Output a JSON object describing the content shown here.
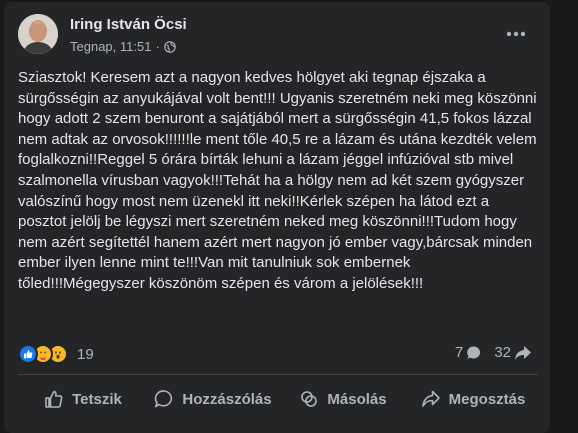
{
  "post": {
    "author": "Iring István Öcsi",
    "timestamp": "Tegnap, 11:51",
    "separator": "·",
    "privacy_icon": "globe-icon",
    "more_icon": "more-options-icon",
    "text": "Sziasztok! Keresem azt a nagyon kedves hölgyet aki tegnap éjszaka a sürgősségin az anyukájával volt bent!!! Ugyanis szeretném neki meg köszönni hogy adott 2 szem benuront a sajátjából mert a sürgősségin 41,5 fokos lázzal nem adtak az orvosok!!!!!!le ment tőle 40,5 re a lázam és utána kezdték velem foglalkozni!!Reggel 5 órára bírták lehuni a lázam jéggel infúzióval stb mivel szalmonella vírusban vagyok!!!Tehát ha a hölgy nem ad két szem gyógyszer valószínű hogy most nem üzenekl itt neki!!Kérlek szépen ha látod ezt a posztot jelölj be légyszi mert szeretném neked meg köszönni!!!Tudom hogy nem azért segítettél hanem azért mert nagyon jó ember vagy,bárcsak minden ember ilyen lenne mint te!!!Van mit tanulniuk sok embernek tőled!!!Mégegyszer köszönöm szépen és várom a jelölések!!!"
  },
  "stats": {
    "reactions": [
      "like",
      "care",
      "wow"
    ],
    "reaction_count": "19",
    "comment_count": "7",
    "share_count": "32"
  },
  "actions": {
    "like_label": "Tetszik",
    "comment_label": "Hozzászólás",
    "copy_label": "Másolás",
    "share_label": "Megosztás"
  },
  "colors": {
    "background": "#18191a",
    "card": "#242526",
    "text_primary": "#e4e6eb",
    "text_secondary": "#b0b3b8",
    "like_blue": "#1877f2",
    "care_yellow": "#f7b928"
  }
}
